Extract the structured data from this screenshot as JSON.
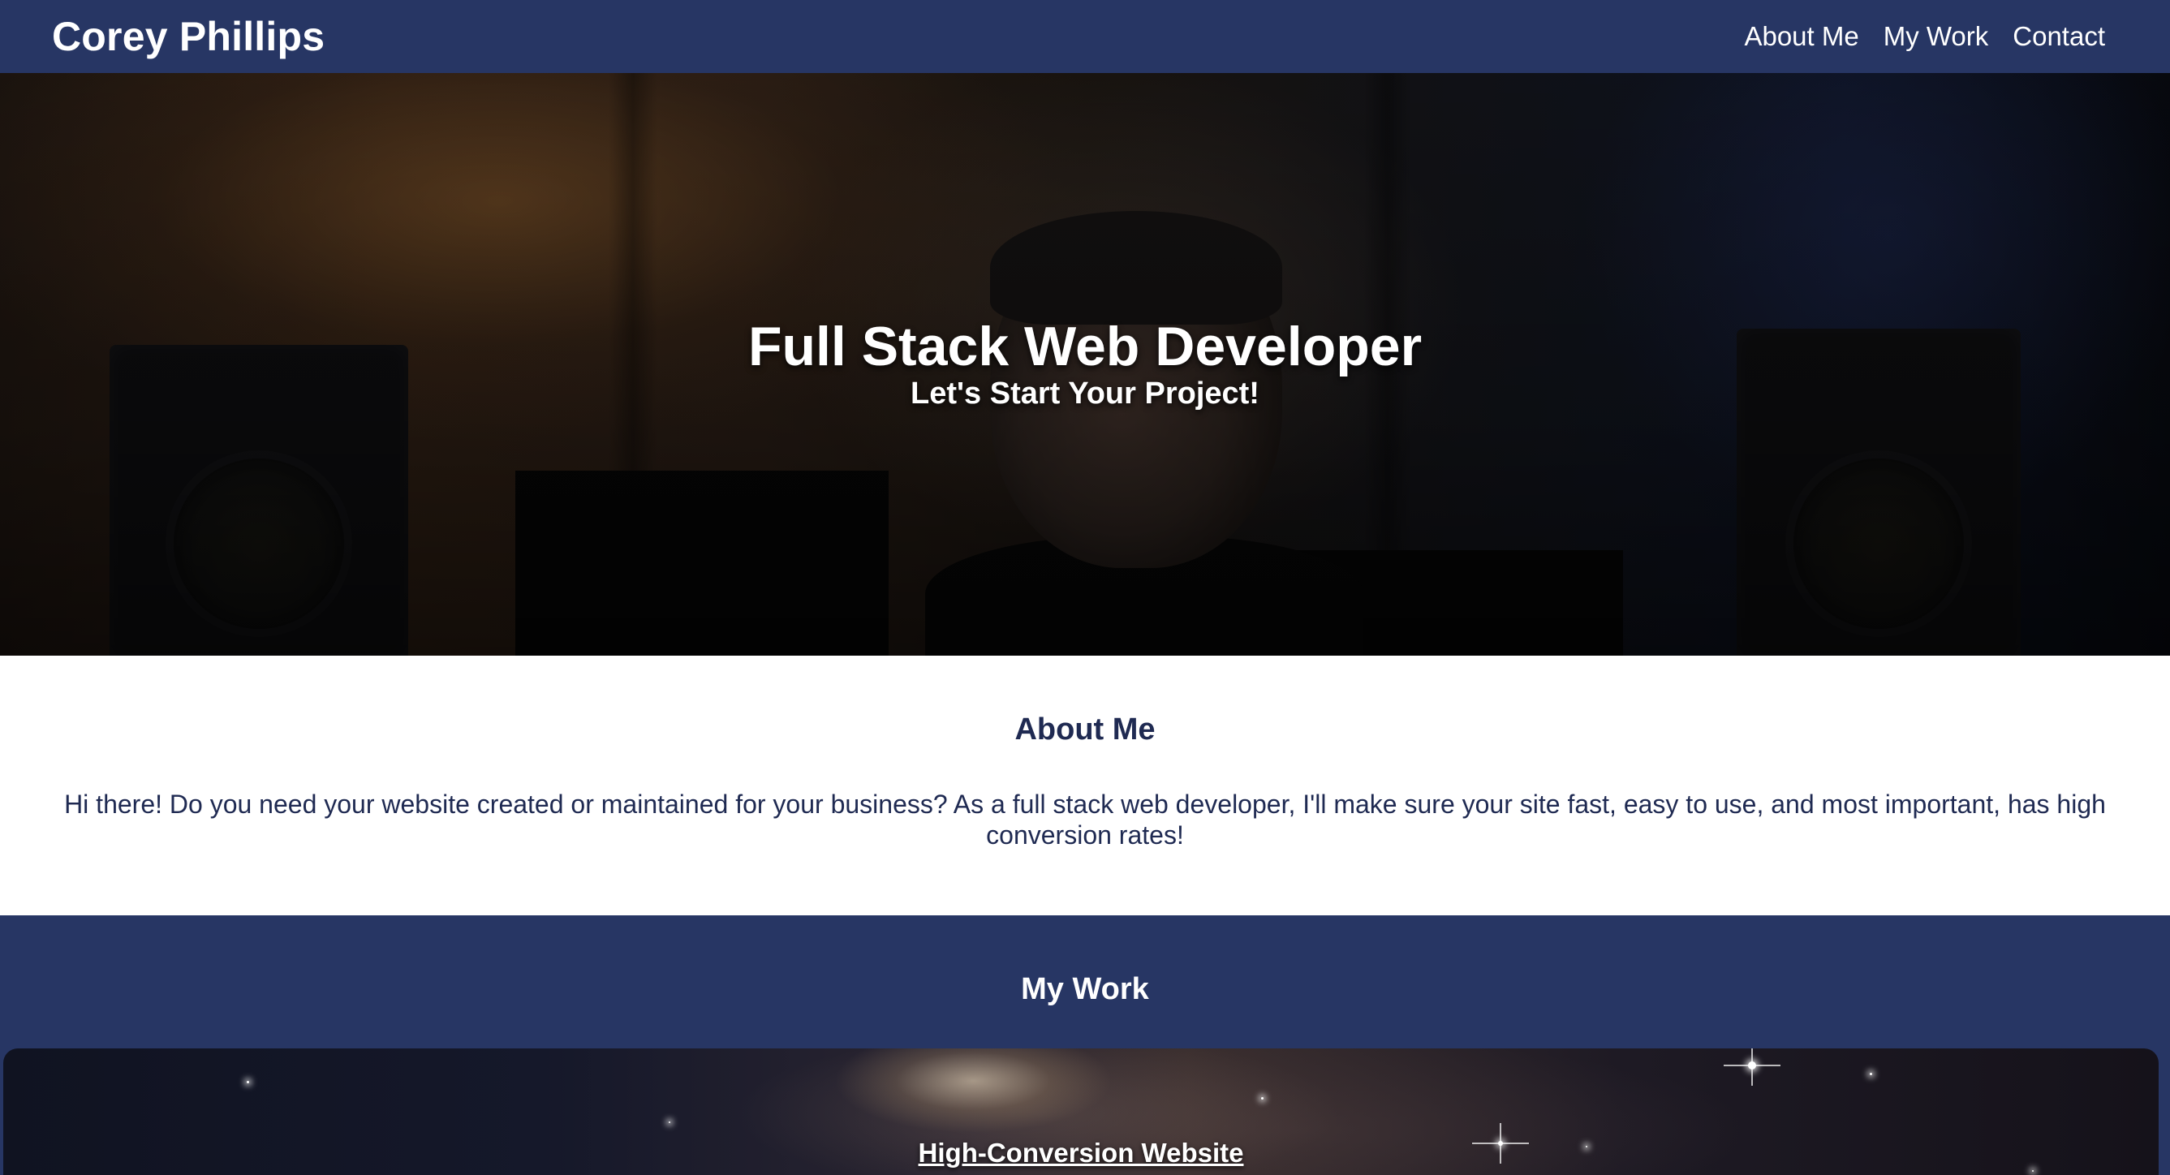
{
  "header": {
    "brand": "Corey Phillips",
    "nav": [
      {
        "label": "About Me"
      },
      {
        "label": "My Work"
      },
      {
        "label": "Contact"
      }
    ]
  },
  "hero": {
    "title": "Full Stack Web Developer",
    "subtitle": "Let's Start Your Project!"
  },
  "about": {
    "heading": "About Me",
    "body": "Hi there! Do you need your website created or maintained for your business? As a full stack web developer, I'll make sure your site fast, easy to use, and most important, has high conversion rates!"
  },
  "work": {
    "heading": "My Work",
    "projects": [
      {
        "title": "High-Conversion Website"
      }
    ]
  },
  "colors": {
    "navy": "#273664",
    "text_navy": "#1f2a52",
    "white": "#ffffff"
  }
}
